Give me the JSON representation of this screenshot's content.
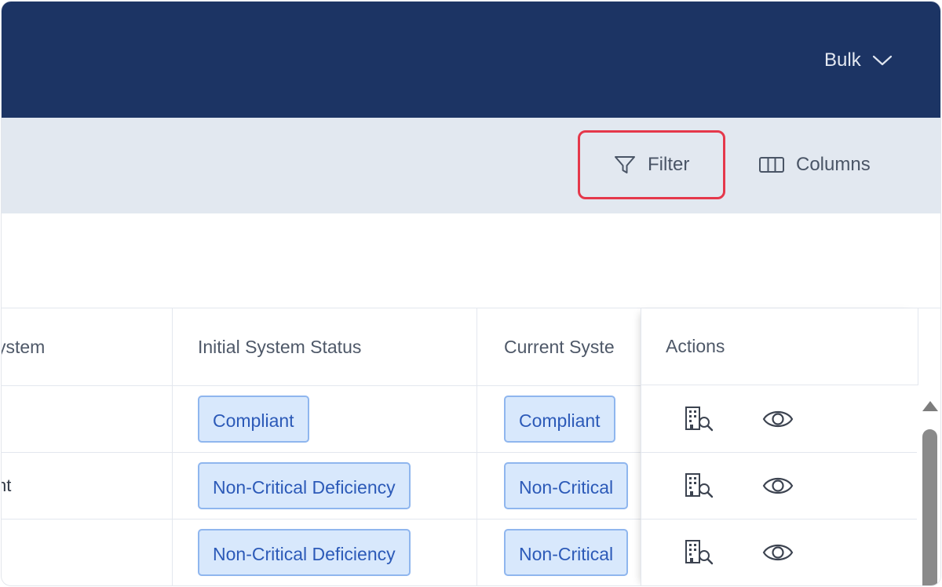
{
  "header": {
    "bulk_label": "Bulk",
    "bulk_icon": "chevron-down-icon",
    "background": "#1c3464"
  },
  "toolbar": {
    "filter_label": "Filter",
    "filter_icon": "filter-icon",
    "columns_label": "Columns",
    "columns_icon": "columns-icon",
    "highlight_color": "#e5384b"
  },
  "table": {
    "columns": [
      "ystem",
      "Initial System Status",
      "Current Syste",
      "Actions"
    ],
    "rows": [
      {
        "system": "",
        "initial_status": "Compliant",
        "current_status": "Compliant"
      },
      {
        "system": "nt",
        "initial_status": "Non-Critical Deficiency",
        "current_status": "Non-Critical"
      },
      {
        "system": "",
        "initial_status": "Non-Critical Deficiency",
        "current_status": "Non-Critical"
      }
    ],
    "action_icons": [
      "building-search-icon",
      "eye-icon"
    ],
    "pill_color": "#d8e8fc",
    "pill_text_color": "#2c5ab8"
  }
}
